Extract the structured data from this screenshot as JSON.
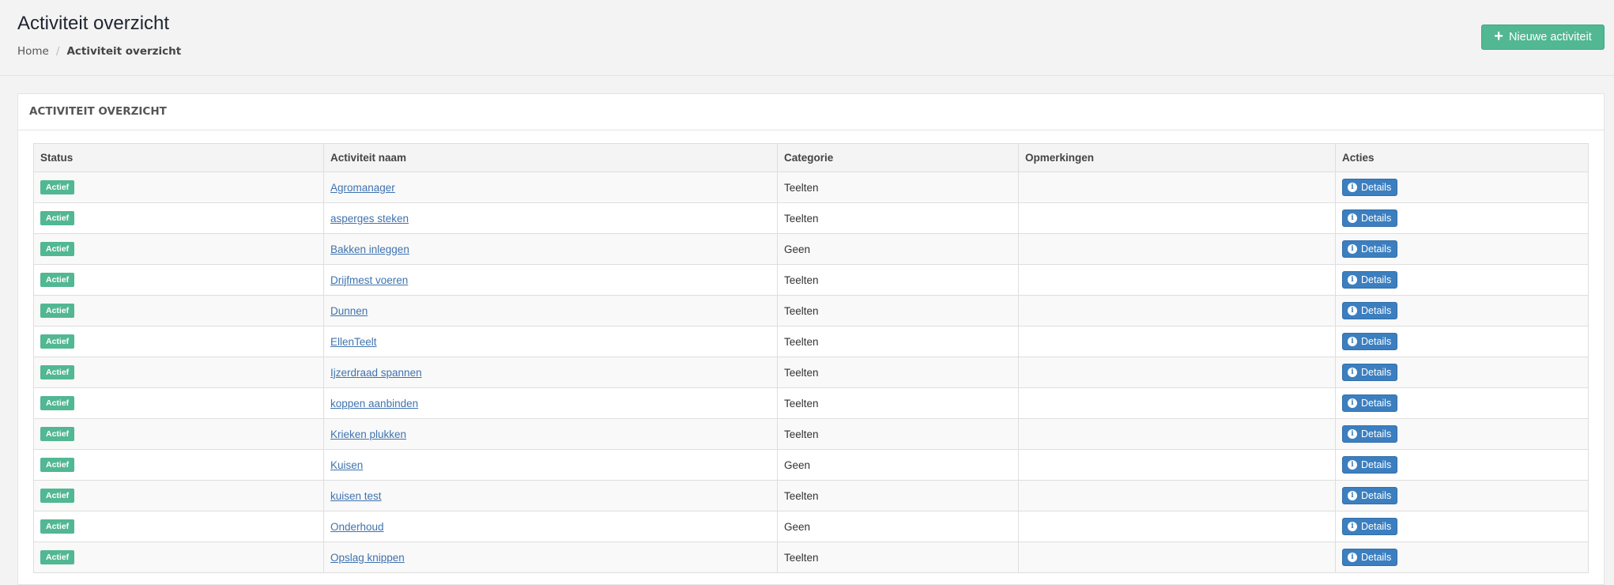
{
  "header": {
    "title": "Activiteit overzicht",
    "breadcrumb": {
      "home": "Home",
      "separator": "/",
      "current": "Activiteit overzicht"
    },
    "new_button": {
      "icon": "plus-icon",
      "label": "Nieuwe activiteit"
    }
  },
  "panel": {
    "title": "ACTIVITEIT OVERZICHT"
  },
  "table": {
    "columns": [
      "Status",
      "Activiteit naam",
      "Categorie",
      "Opmerkingen",
      "Acties"
    ],
    "rows": [
      {
        "status": "Actief",
        "name": "Agromanager",
        "category": "Teelten",
        "remarks": "",
        "action": "Details"
      },
      {
        "status": "Actief",
        "name": "asperges steken",
        "category": "Teelten",
        "remarks": "",
        "action": "Details"
      },
      {
        "status": "Actief",
        "name": "Bakken inleggen",
        "category": "Geen",
        "remarks": "",
        "action": "Details"
      },
      {
        "status": "Actief",
        "name": "Drijfmest voeren",
        "category": "Teelten",
        "remarks": "",
        "action": "Details"
      },
      {
        "status": "Actief",
        "name": "Dunnen",
        "category": "Teelten",
        "remarks": "",
        "action": "Details"
      },
      {
        "status": "Actief",
        "name": "EllenTeelt",
        "category": "Teelten",
        "remarks": "",
        "action": "Details"
      },
      {
        "status": "Actief",
        "name": "Ijzerdraad spannen",
        "category": "Teelten",
        "remarks": "",
        "action": "Details"
      },
      {
        "status": "Actief",
        "name": "koppen aanbinden",
        "category": "Teelten",
        "remarks": "",
        "action": "Details"
      },
      {
        "status": "Actief",
        "name": "Krieken plukken",
        "category": "Teelten",
        "remarks": "",
        "action": "Details"
      },
      {
        "status": "Actief",
        "name": "Kuisen",
        "category": "Geen",
        "remarks": "",
        "action": "Details"
      },
      {
        "status": "Actief",
        "name": "kuisen test",
        "category": "Teelten",
        "remarks": "",
        "action": "Details"
      },
      {
        "status": "Actief",
        "name": "Onderhoud",
        "category": "Geen",
        "remarks": "",
        "action": "Details"
      },
      {
        "status": "Actief",
        "name": "Opslag knippen",
        "category": "Teelten",
        "remarks": "",
        "action": "Details"
      }
    ]
  },
  "colors": {
    "accent_green": "#52b793",
    "details_blue": "#3c7fc0",
    "link_blue": "#3f73ae"
  }
}
